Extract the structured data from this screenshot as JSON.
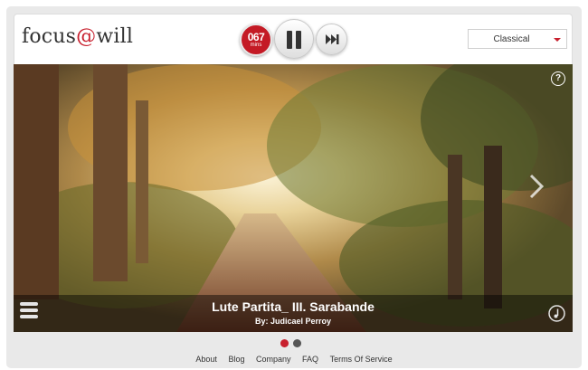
{
  "header": {
    "logo_part1": "focus",
    "logo_at": "@",
    "logo_part2": "will",
    "timer_value": "067",
    "timer_unit": "mins",
    "pause_icon": "pause-icon",
    "skip_icon": "skip-forward-icon",
    "genre_selected": "Classical"
  },
  "player": {
    "help_label": "?",
    "track_title": "Lute Partita_ III. Sarabande",
    "track_artist": "By: Judicael Perroy",
    "next_icon": "chevron-right-icon",
    "menu_icon": "hamburger-menu-icon",
    "note_icon": "music-note-icon"
  },
  "pagination": {
    "count": 2,
    "active": 1
  },
  "footer": {
    "links": [
      "About",
      "Blog",
      "Company",
      "FAQ",
      "Terms Of Service"
    ]
  },
  "colors": {
    "brand_red": "#c8202e",
    "timer_red": "#c41a25",
    "outer_bg": "#e9e9e9"
  }
}
